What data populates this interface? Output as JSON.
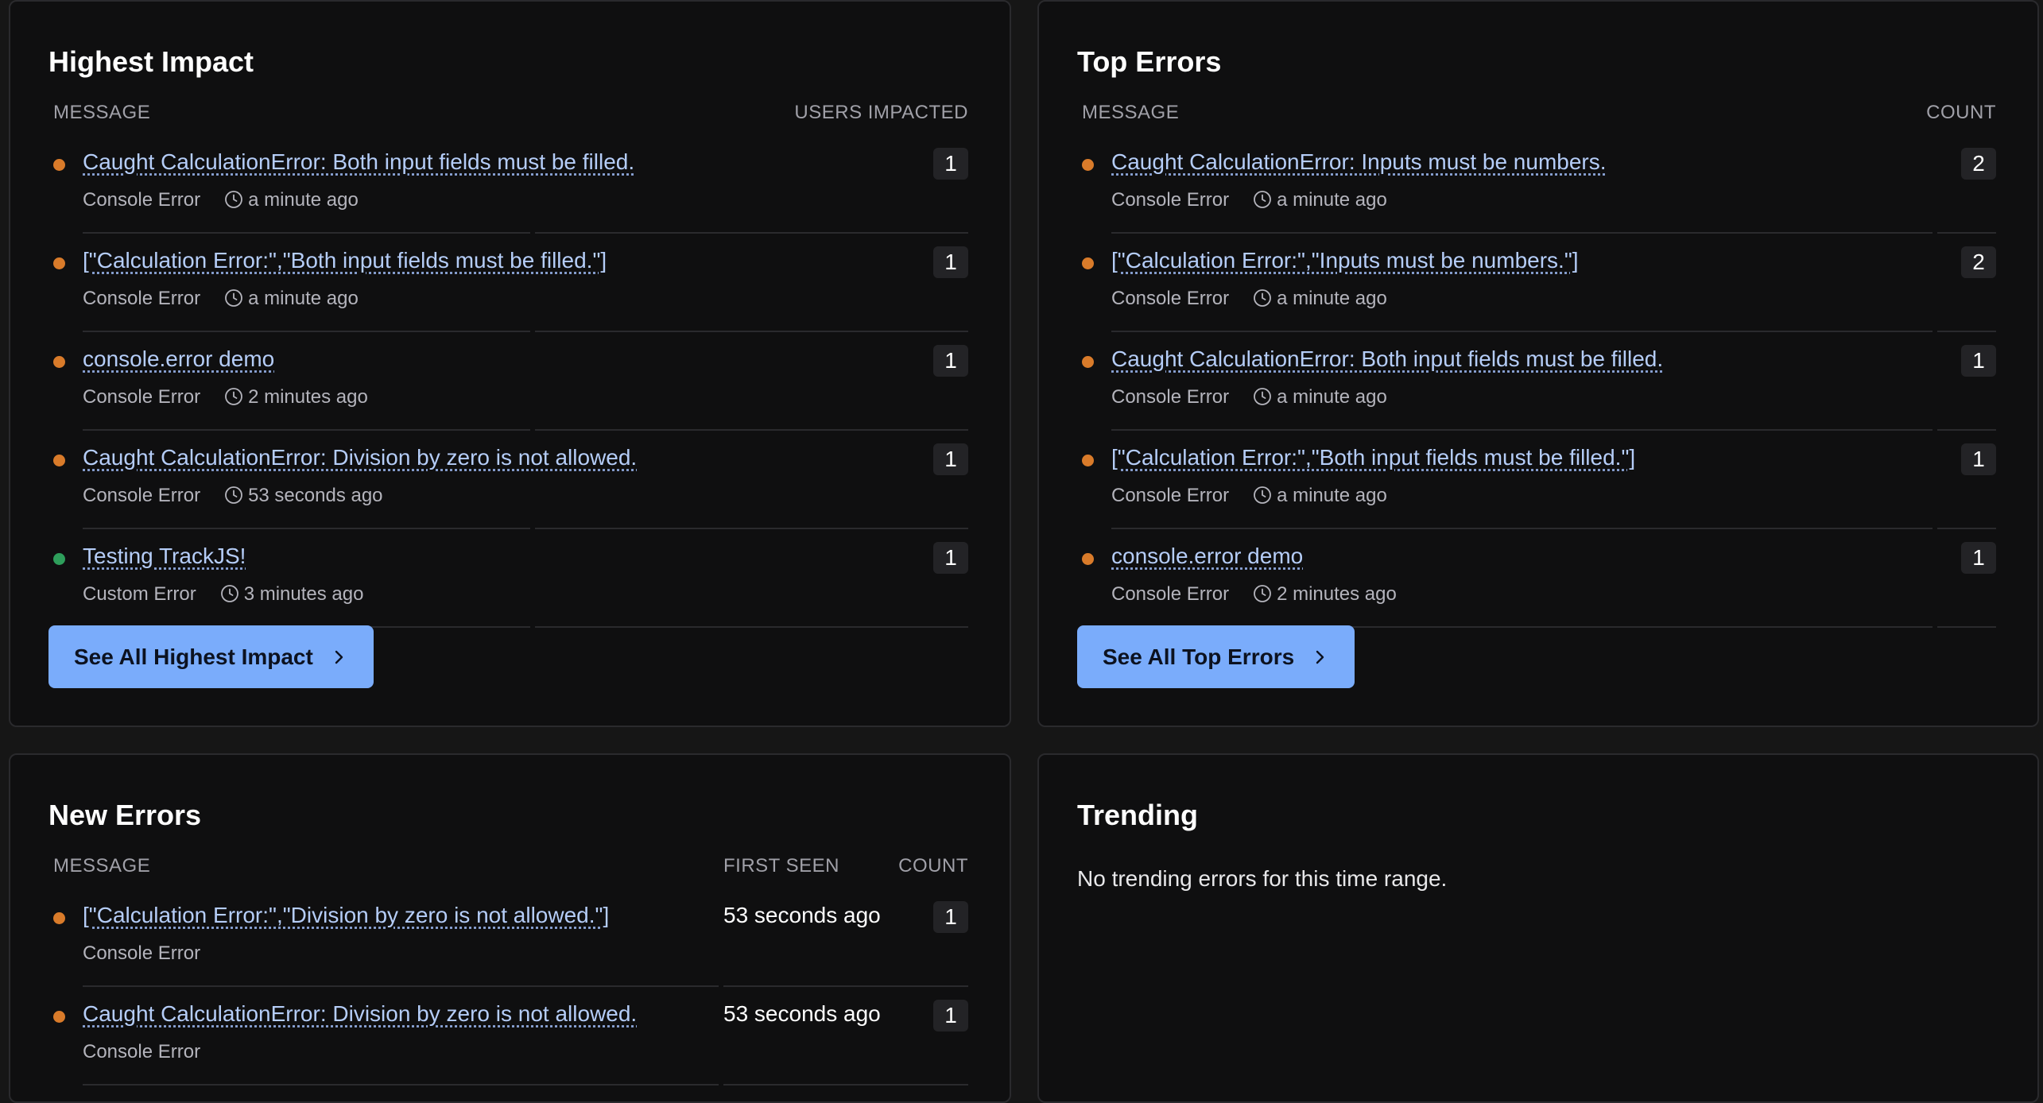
{
  "colors": {
    "orange_dot": "#d97b2a",
    "green_dot": "#2e9e5b",
    "accent": "#7aacfb"
  },
  "highest_impact": {
    "title": "Highest Impact",
    "col_message": "MESSAGE",
    "col_right": "USERS IMPACTED",
    "rows": [
      {
        "message": "Caught CalculationError: Both input fields must be filled.",
        "type": "Console Error",
        "time": "a minute ago",
        "count": "1",
        "dot": "orange"
      },
      {
        "message": "[\"Calculation Error:\",\"Both input fields must be filled.\"]",
        "type": "Console Error",
        "time": "a minute ago",
        "count": "1",
        "dot": "orange"
      },
      {
        "message": "console.error demo",
        "type": "Console Error",
        "time": "2 minutes ago",
        "count": "1",
        "dot": "orange"
      },
      {
        "message": "Caught CalculationError: Division by zero is not allowed.",
        "type": "Console Error",
        "time": "53 seconds ago",
        "count": "1",
        "dot": "orange"
      },
      {
        "message": "Testing TrackJS!",
        "type": "Custom Error",
        "time": "3 minutes ago",
        "count": "1",
        "dot": "green"
      }
    ],
    "button": "See All Highest Impact"
  },
  "top_errors": {
    "title": "Top Errors",
    "col_message": "MESSAGE",
    "col_right": "COUNT",
    "rows": [
      {
        "message": "Caught CalculationError: Inputs must be numbers.",
        "type": "Console Error",
        "time": "a minute ago",
        "count": "2",
        "dot": "orange"
      },
      {
        "message": "[\"Calculation Error:\",\"Inputs must be numbers.\"]",
        "type": "Console Error",
        "time": "a minute ago",
        "count": "2",
        "dot": "orange"
      },
      {
        "message": "Caught CalculationError: Both input fields must be filled.",
        "type": "Console Error",
        "time": "a minute ago",
        "count": "1",
        "dot": "orange"
      },
      {
        "message": "[\"Calculation Error:\",\"Both input fields must be filled.\"]",
        "type": "Console Error",
        "time": "a minute ago",
        "count": "1",
        "dot": "orange"
      },
      {
        "message": "console.error demo",
        "type": "Console Error",
        "time": "2 minutes ago",
        "count": "1",
        "dot": "orange"
      }
    ],
    "button": "See All Top Errors"
  },
  "new_errors": {
    "title": "New Errors",
    "col_message": "MESSAGE",
    "col_first_seen": "FIRST SEEN",
    "col_right": "COUNT",
    "rows": [
      {
        "message": "[\"Calculation Error:\",\"Division by zero is not allowed.\"]",
        "type": "Console Error",
        "first_seen": "53 seconds ago",
        "count": "1",
        "dot": "orange"
      },
      {
        "message": "Caught CalculationError: Division by zero is not allowed.",
        "type": "Console Error",
        "first_seen": "53 seconds ago",
        "count": "1",
        "dot": "orange"
      }
    ]
  },
  "trending": {
    "title": "Trending",
    "empty_message": "No trending errors for this time range."
  }
}
